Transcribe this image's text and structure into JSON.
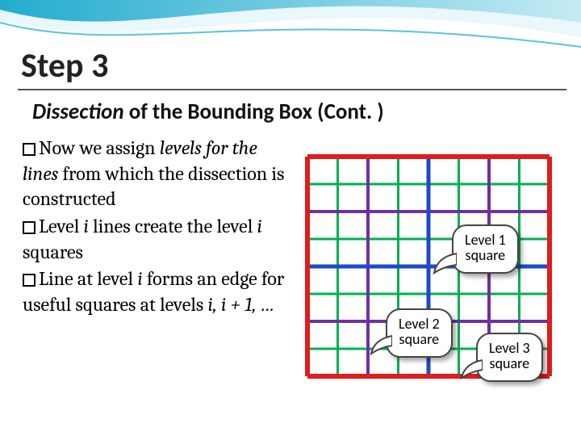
{
  "title": "Step 3",
  "subtitle_parts": {
    "pre": "Dissection",
    "post": " of the Bounding Box (Cont. )"
  },
  "bullets": [
    {
      "plain1": "Now we assign ",
      "em1": "levels for the lines",
      "plain2": " from which the dissection is constructed"
    },
    {
      "plain1": "Level ",
      "em1": "i",
      "plain2": " lines create the level ",
      "em2": "i",
      "plain3": " squares"
    },
    {
      "plain1": "Line at level ",
      "em1": "i",
      "plain2": " forms an edge for useful squares at levels ",
      "em2": "i, i + 1, …",
      "plain3": ""
    }
  ],
  "callouts": {
    "level1": {
      "line1": "Level 1",
      "line2": "square"
    },
    "level2": {
      "line1": "Level 2",
      "line2": "square"
    },
    "level3": {
      "line1": "Level 3",
      "line2": "square"
    }
  },
  "grid": {
    "levels": [
      {
        "name": "level1",
        "color": "#e21b1b",
        "stroke": 6,
        "divisions": 1
      },
      {
        "name": "level2",
        "color": "#1e49c9",
        "stroke": 5,
        "divisions": 2
      },
      {
        "name": "level3",
        "color": "#7030a0",
        "stroke": 4,
        "divisions": 4
      },
      {
        "name": "level4",
        "color": "#00b050",
        "stroke": 3,
        "divisions": 8
      }
    ],
    "size": 280
  }
}
